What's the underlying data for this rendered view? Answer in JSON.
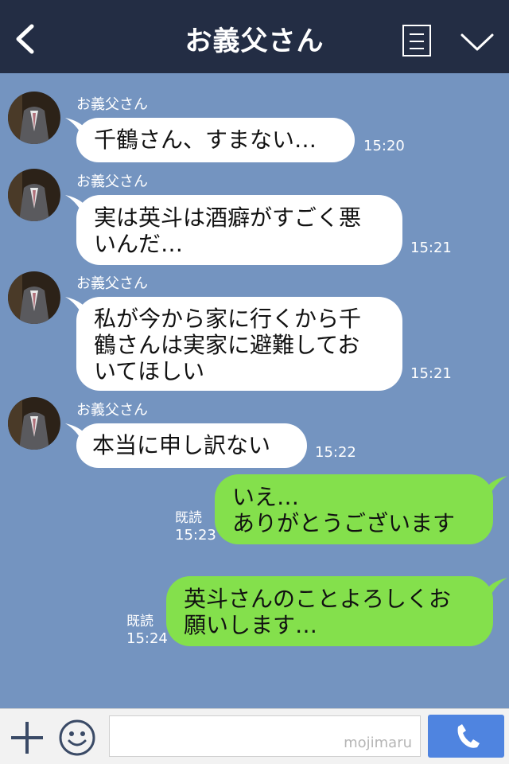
{
  "header": {
    "title": "お義父さん"
  },
  "messages": [
    {
      "sender": "お義父さん",
      "lines": [
        "千鶴さん、すまない…"
      ],
      "time": "15:20"
    },
    {
      "sender": "お義父さん",
      "lines": [
        "実は英斗は酒癖がすごく悪",
        "いんだ…"
      ],
      "time": "15:21"
    },
    {
      "sender": "お義父さん",
      "lines": [
        "私が今から家に行くから千",
        "鶴さんは実家に避難してお",
        "いてほしい"
      ],
      "time": "15:21"
    },
    {
      "sender": "お義父さん",
      "lines": [
        "本当に申し訳ない"
      ],
      "time": "15:22"
    },
    {
      "read": "既読",
      "time": "15:23",
      "lines": [
        "いえ…",
        "ありがとうございます"
      ]
    },
    {
      "read": "既読",
      "time": "15:24",
      "lines": [
        "英斗さんのことよろしくお",
        "願いします…"
      ]
    }
  ],
  "footer": {
    "watermark": "mojimaru"
  },
  "colors": {
    "header": "#232d44",
    "background": "#7494c0",
    "incoming": "#ffffff",
    "outgoing": "#84e04c",
    "call_button": "#4f84e0"
  }
}
